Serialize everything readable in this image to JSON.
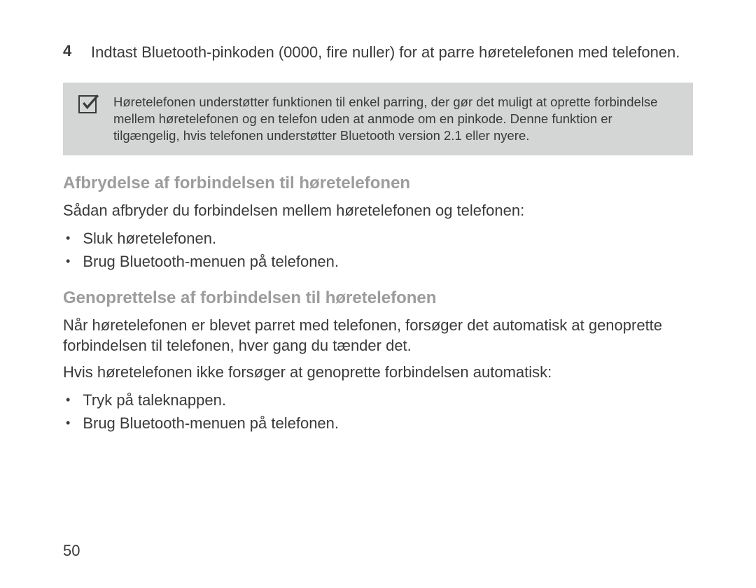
{
  "step": {
    "number": "4",
    "text": "Indtast Bluetooth-pinkoden (0000, fire nuller) for at parre høretelefonen med telefonen."
  },
  "note": {
    "text": "Høretelefonen understøtter funktionen til enkel parring, der gør det muligt at oprette forbindelse mellem høretelefonen og en telefon uden at anmode om en pinkode. Denne funktion er tilgængelig, hvis telefonen understøtter Bluetooth version 2.1 eller nyere."
  },
  "section1": {
    "heading": "Afbrydelse af forbindelsen til høretelefonen",
    "intro": "Sådan afbryder du forbindelsen mellem høretelefonen og telefonen:",
    "bullets": [
      "Sluk høretelefonen.",
      "Brug Bluetooth-menuen på telefonen."
    ]
  },
  "section2": {
    "heading": "Genoprettelse af forbindelsen til høretelefonen",
    "para1": "Når høretelefonen er blevet parret med telefonen, forsøger det automatisk at genoprette forbindelsen til telefonen, hver gang du tænder det.",
    "para2": "Hvis høretelefonen ikke forsøger at genoprette forbindelsen automatisk:",
    "bullets": [
      "Tryk på taleknappen.",
      "Brug Bluetooth-menuen på telefonen."
    ]
  },
  "pageNumber": "50"
}
